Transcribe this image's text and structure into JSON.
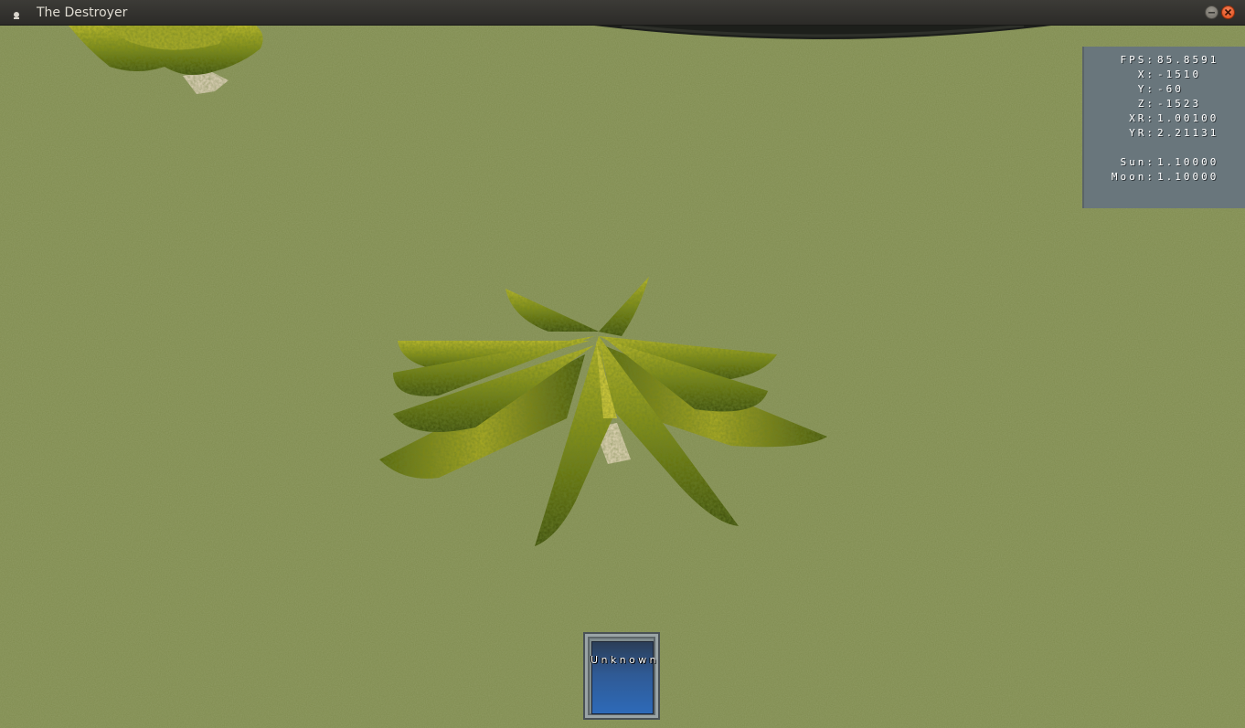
{
  "window": {
    "title": "The Destroyer"
  },
  "titlebar_icons": {
    "app_icon": "window-icon",
    "minimize": "minimize-icon",
    "close": "close-icon"
  },
  "hud": {
    "rows": [
      {
        "label": "FPS:",
        "value": "85.8591"
      },
      {
        "label": "X:",
        "value": "-1510"
      },
      {
        "label": "Y:",
        "value": "-60"
      },
      {
        "label": "Z:",
        "value": "-1523"
      },
      {
        "label": "XR:",
        "value": "1.00100"
      },
      {
        "label": "YR:",
        "value": "2.21131"
      },
      {
        "label": "Sun:",
        "value": "1.10000"
      },
      {
        "label": "Moon:",
        "value": "1.10000"
      }
    ]
  },
  "item_slot": {
    "label": "Unknown"
  },
  "colors": {
    "ground": "#7f8b4f",
    "hud_panel": "#69767c",
    "slot_blue": "#2e6ab8",
    "close_button": "#df4a16"
  }
}
